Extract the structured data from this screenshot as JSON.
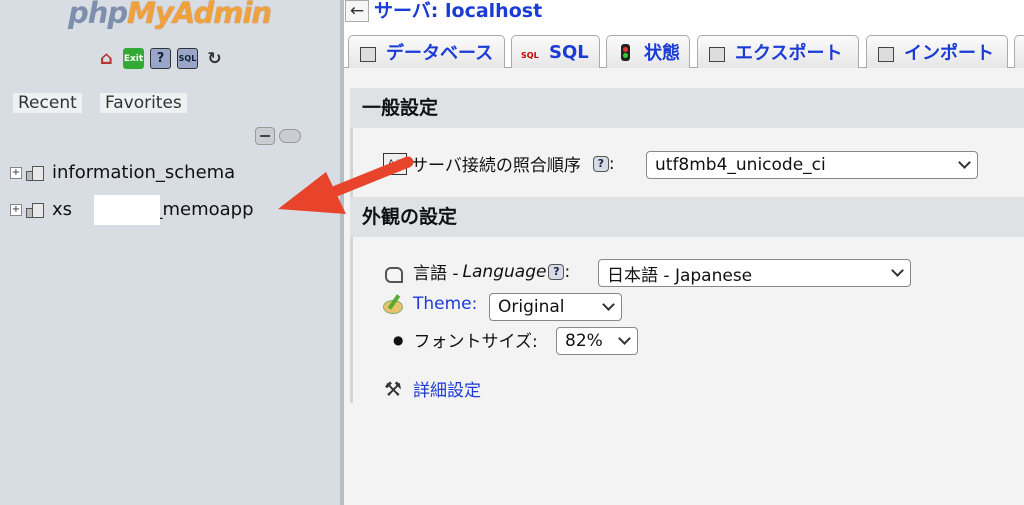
{
  "nav": {
    "logo_php": "php",
    "logo_rest": "MyAdmin",
    "quick_icons": [
      "home-icon",
      "exit-icon",
      "help-icon",
      "sql-icon",
      "reload-icon"
    ],
    "tabs": {
      "recent": "Recent",
      "favorites": "Favorites"
    },
    "databases": [
      {
        "name": "information_schema"
      },
      {
        "name": "xs",
        "name_suffix": "3_memoapp"
      }
    ]
  },
  "main": {
    "back_label": "←",
    "server_title": "サーバ: localhost",
    "tabs": [
      {
        "label": "データベース",
        "icon": "database-icon"
      },
      {
        "label": "SQL",
        "icon": "sql-icon"
      },
      {
        "label": "状態",
        "icon": "status-icon"
      },
      {
        "label": "エクスポート",
        "icon": "export-icon"
      },
      {
        "label": "インポート",
        "icon": "import-icon"
      }
    ],
    "general": {
      "heading": "一般設定",
      "collation_label": "サーバ接続の照合順序",
      "collation_value": "utf8mb4_unicode_ci"
    },
    "appearance": {
      "heading": "外観の設定",
      "language_label": "言語 - ",
      "language_label_italic": "Language",
      "language_value": "日本語 - Japanese",
      "theme_label": "Theme:",
      "theme_value": "Original",
      "font_label": "フォントサイズ:",
      "font_value": "82%",
      "advanced_label": "詳細設定"
    }
  },
  "colors": {
    "annotation_arrow": "#e8432b",
    "link": "#1a3bd6",
    "nav_bg": "#d7dde2"
  }
}
